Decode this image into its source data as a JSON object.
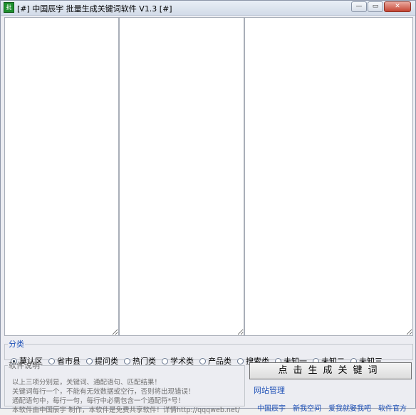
{
  "window": {
    "title": "[#]  中国辰宇  批量生成关键词软件 V1.3 [#]",
    "icon_label": "批"
  },
  "panes": [
    "keywords",
    "patterns",
    "results"
  ],
  "category": {
    "legend": "分类",
    "options": [
      "莫认区",
      "省市县",
      "提问类",
      "热门类",
      "学术类",
      "产品类",
      "搜索类",
      "未知一",
      "未知二",
      "未知三"
    ],
    "selected_index": 0
  },
  "description": {
    "legend": "软件说明",
    "lines": [
      "以上三项分别是，关键词、通配语句、匹配结果！",
      "关键词每行一个，不能有无效数据或空行，否则将出现错误！",
      "通配语句中，每行一句，每行中必需包含一个通配符*号！",
      "本软件由中国辰宇 制作，本软件是免费共享软件！详情http://qqqweb.net/"
    ]
  },
  "generate_button": {
    "label": "点击生成关键词"
  },
  "site_management": {
    "legend": "网站管理",
    "links": [
      "中国辰宇",
      "新我空间",
      "爱我就娶我吧",
      "软件官方"
    ]
  }
}
